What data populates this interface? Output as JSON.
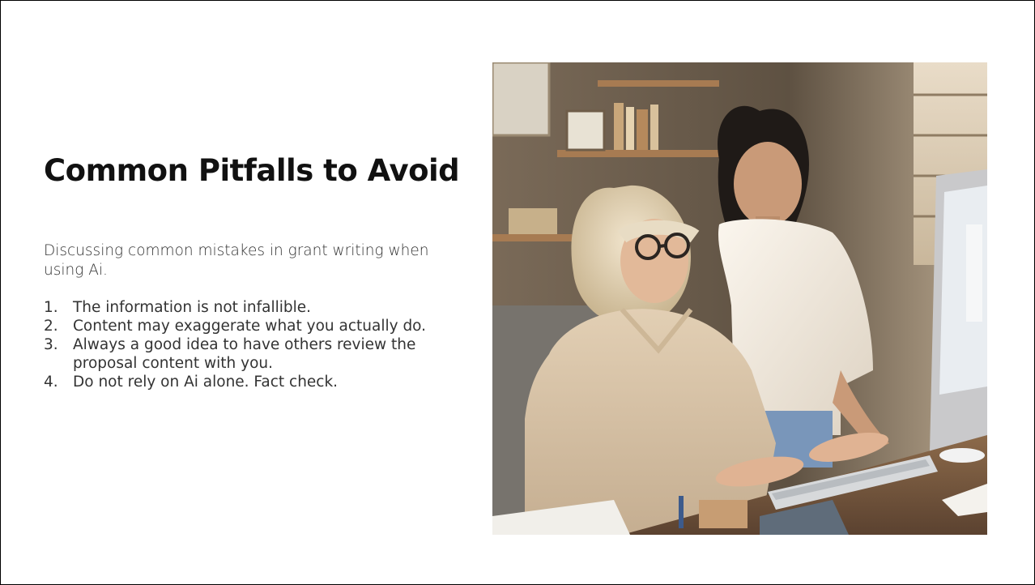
{
  "slide": {
    "title": "Common Pitfalls to Avoid",
    "subtitle": "Discussing common mistakes in grant writing when using Ai.",
    "items": [
      {
        "num": "1.",
        "text": "The information is not infallible."
      },
      {
        "num": "2.",
        "text": "Content may exaggerate what you actually do."
      },
      {
        "num": "3.",
        "text": "Always a good idea to have others review the proposal content with you."
      },
      {
        "num": "4.",
        "text": "Do not rely on Ai alone. Fact check."
      }
    ]
  },
  "photo": {
    "icon": "photo-two-women-at-computer"
  }
}
